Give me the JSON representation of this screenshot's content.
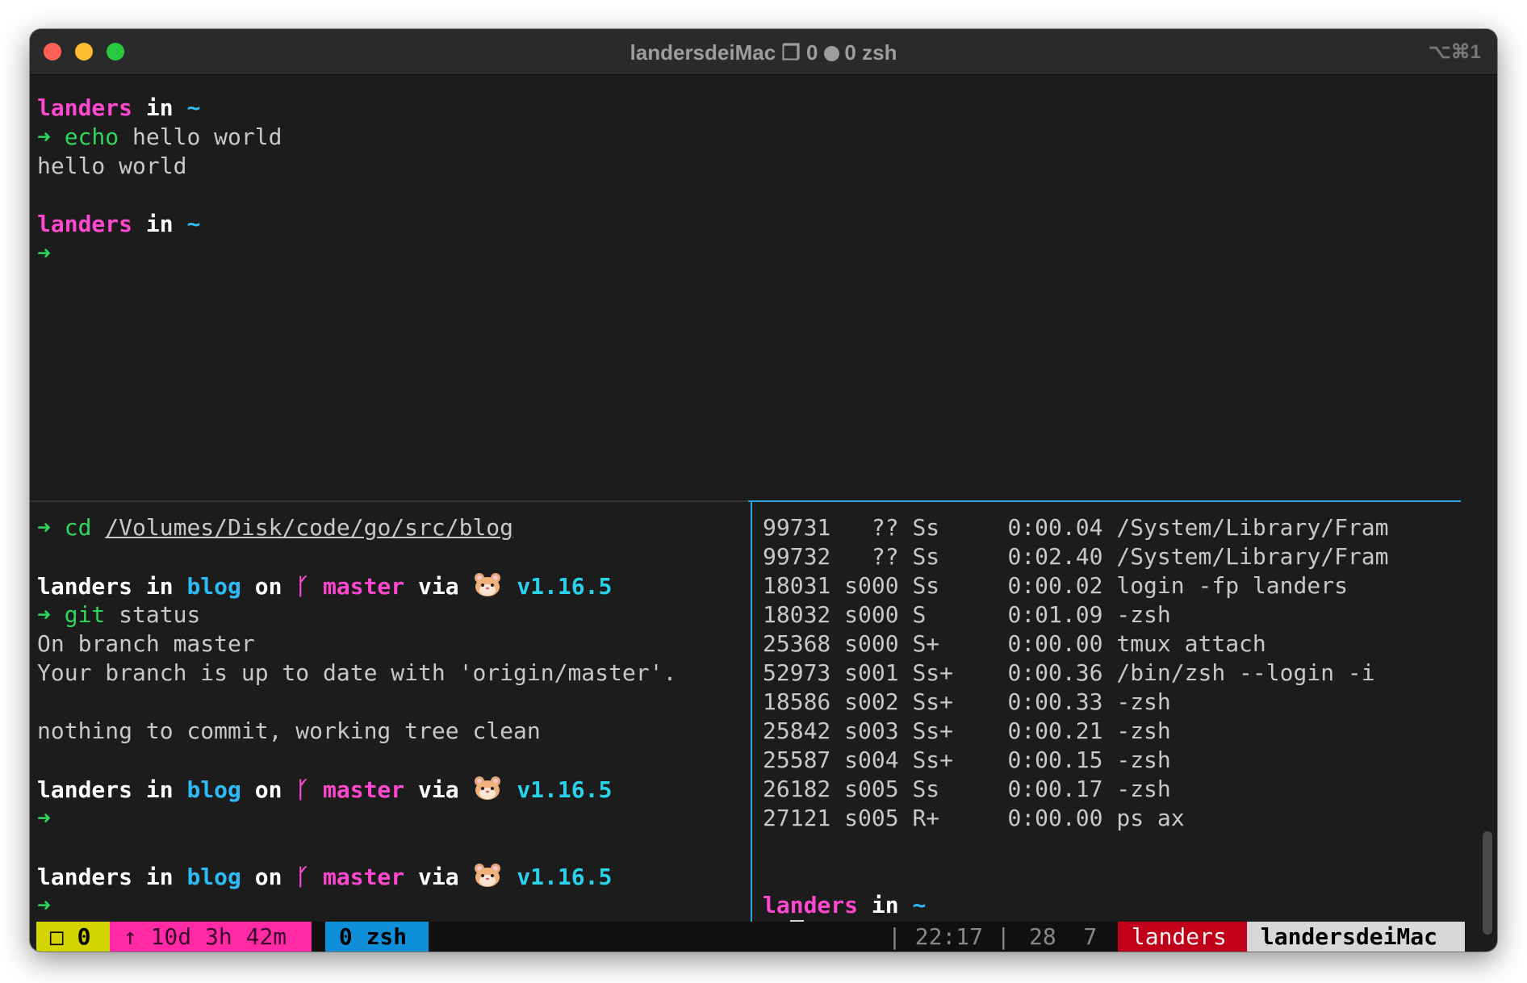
{
  "window": {
    "title_host": "landersdeiMac",
    "title_window_glyph": "❐",
    "title_window_index": "0",
    "title_session": "0 zsh",
    "shortcut": "⌥⌘1"
  },
  "colors": {
    "prompt_user": "#ff48d0",
    "prompt_dir": "#2ebbf5",
    "command": "#30d65b",
    "active_border": "#2aa4dd"
  },
  "top_pane": {
    "user": "landers",
    "in": "in",
    "dir": "~",
    "arrow": "➜",
    "cmd": "echo",
    "args": "hello world",
    "output": "hello world"
  },
  "bottom_left": {
    "cd_cmd": "cd",
    "cd_path": "/Volumes/Disk/code/go/src/blog",
    "user": "landers",
    "in": "in",
    "dir": "blog",
    "on": "on",
    "branch_icon": "ᚴ",
    "branch": "master",
    "via": "via",
    "go_icon": "hamster-icon",
    "version": "v1.16.5",
    "arrow": "➜",
    "git_cmd": "git",
    "git_args": "status",
    "out1": "On branch master",
    "out2": "Your branch is up to date with 'origin/master'.",
    "out3": "nothing to commit, working tree clean"
  },
  "bottom_right": {
    "processes": [
      {
        "pid": "99731",
        "tty": "  ??",
        "stat": "Ss ",
        "time": "0:00.04",
        "cmd": "/System/Library/Fram"
      },
      {
        "pid": "99732",
        "tty": "  ??",
        "stat": "Ss ",
        "time": "0:02.40",
        "cmd": "/System/Library/Fram"
      },
      {
        "pid": "18031",
        "tty": "s000",
        "stat": "Ss ",
        "time": "0:00.02",
        "cmd": "login -fp landers"
      },
      {
        "pid": "18032",
        "tty": "s000",
        "stat": "S  ",
        "time": "0:01.09",
        "cmd": "-zsh"
      },
      {
        "pid": "25368",
        "tty": "s000",
        "stat": "S+ ",
        "time": "0:00.00",
        "cmd": "tmux attach"
      },
      {
        "pid": "52973",
        "tty": "s001",
        "stat": "Ss+",
        "time": "0:00.36",
        "cmd": "/bin/zsh --login -i"
      },
      {
        "pid": "18586",
        "tty": "s002",
        "stat": "Ss+",
        "time": "0:00.33",
        "cmd": "-zsh"
      },
      {
        "pid": "25842",
        "tty": "s003",
        "stat": "Ss+",
        "time": "0:00.21",
        "cmd": "-zsh"
      },
      {
        "pid": "25587",
        "tty": "s004",
        "stat": "Ss+",
        "time": "0:00.15",
        "cmd": "-zsh"
      },
      {
        "pid": "26182",
        "tty": "s005",
        "stat": "Ss ",
        "time": "0:00.17",
        "cmd": "-zsh"
      },
      {
        "pid": "27121",
        "tty": "s005",
        "stat": "R+ ",
        "time": "0:00.00",
        "cmd": "ps ax"
      }
    ],
    "user": "landers",
    "in": "in",
    "dir": "~",
    "arrow": "➜"
  },
  "status_bar": {
    "window_glyph": "□",
    "window_index": "0",
    "uptime": "↑ 10d 3h 42m",
    "session": "0 zsh",
    "time": "| 22:17 |",
    "load": "28  7",
    "user": "landers",
    "host": "landersdeiMac"
  }
}
